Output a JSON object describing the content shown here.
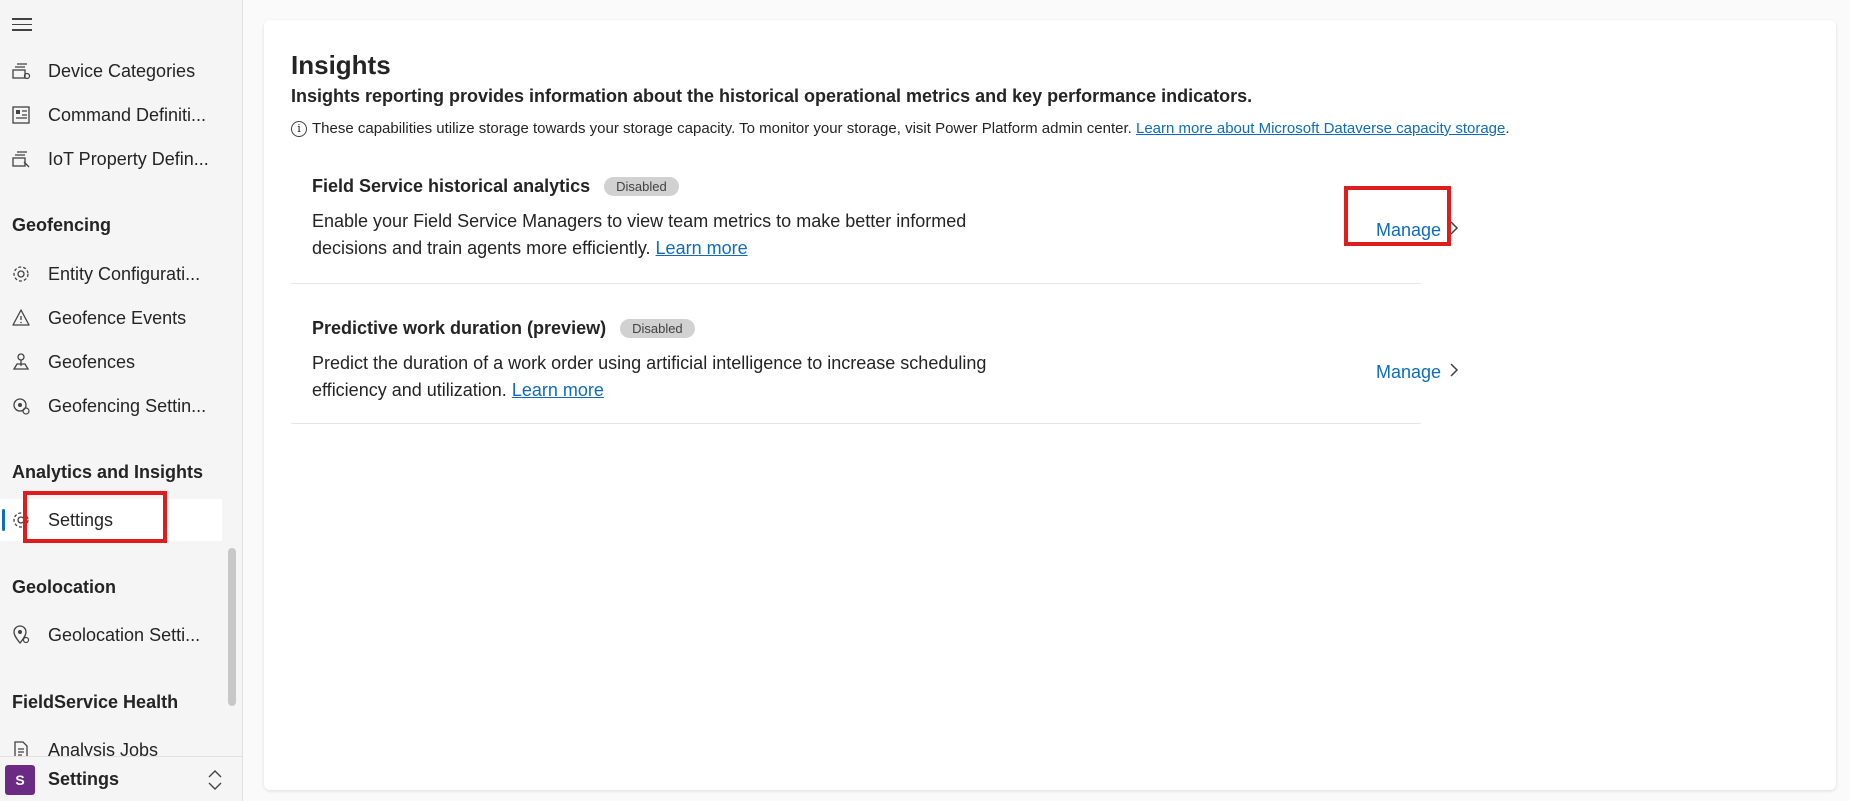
{
  "sidebar": {
    "items_top": [
      {
        "label": "Device Categories",
        "icon": "device-categories-icon"
      },
      {
        "label": "Command Definiti...",
        "icon": "command-definition-icon"
      },
      {
        "label": "IoT Property Defin...",
        "icon": "iot-property-icon"
      }
    ],
    "sections": {
      "geofencing": "Geofencing",
      "analytics": "Analytics and Insights",
      "geolocation": "Geolocation",
      "health": "FieldService Health"
    },
    "geofencing_items": [
      {
        "label": "Entity Configurati...",
        "icon": "gear-icon"
      },
      {
        "label": "Geofence Events",
        "icon": "warning-icon"
      },
      {
        "label": "Geofences",
        "icon": "geofence-pin-icon"
      },
      {
        "label": "Geofencing Settin...",
        "icon": "geofence-settings-icon"
      }
    ],
    "analytics_items": [
      {
        "label": "Settings",
        "icon": "gear-icon"
      }
    ],
    "geolocation_items": [
      {
        "label": "Geolocation Setti...",
        "icon": "geolocation-settings-icon"
      }
    ],
    "health_items": [
      {
        "label": "Analysis Jobs",
        "icon": "document-icon"
      }
    ],
    "footer": {
      "avatar_letter": "S",
      "label": "Settings"
    }
  },
  "main": {
    "title": "Insights",
    "subtitle": "Insights reporting provides information about the historical operational metrics and key performance indicators.",
    "info_text": "These capabilities utilize storage towards your storage capacity. To monitor your storage, visit Power Platform admin center.",
    "info_link": "Learn more about Microsoft Dataverse capacity storage",
    "info_after": ".",
    "features": [
      {
        "name": "Field Service historical analytics",
        "badge": "Disabled",
        "description": "Enable your Field Service Managers to view team metrics to make better informed decisions and train agents more efficiently.",
        "learn_more": "Learn more",
        "manage": "Manage"
      },
      {
        "name": "Predictive work duration (preview)",
        "badge": "Disabled",
        "description": "Predict the duration of a work order using artificial intelligence to increase scheduling efficiency and utilization.",
        "learn_more": "Learn more",
        "manage": "Manage"
      }
    ]
  },
  "colors": {
    "accent": "#0f6cbd",
    "highlight_box": "#e01c1c",
    "avatar": "#6b2a83"
  }
}
